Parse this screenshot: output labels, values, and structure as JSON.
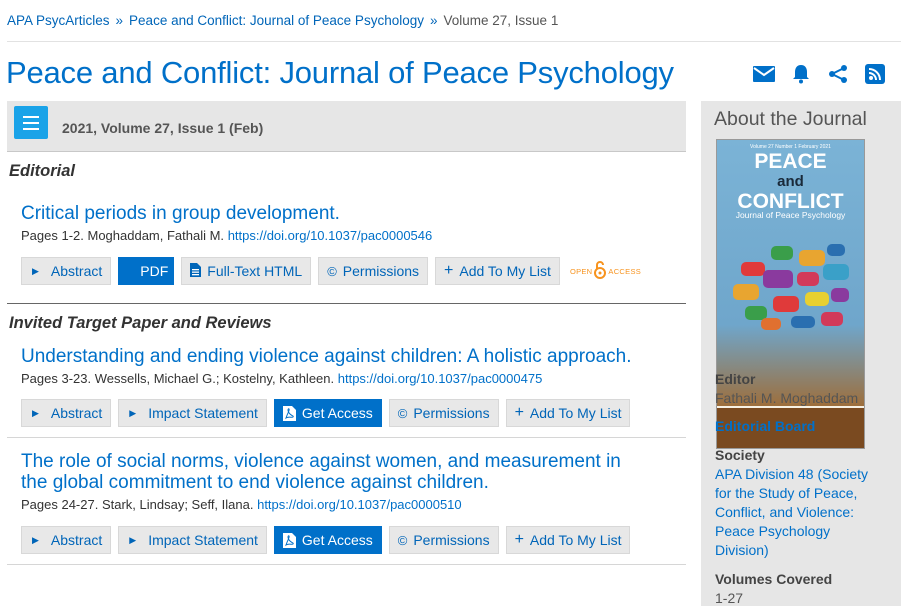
{
  "breadcrumb": {
    "items": [
      "APA PsycArticles",
      "Peace and Conflict: Journal of Peace Psychology",
      "Volume 27, Issue 1"
    ],
    "separator": "»"
  },
  "header": {
    "title": "Peace and Conflict: Journal of Peace Psychology",
    "icons": [
      "email-icon",
      "bell-icon",
      "share-icon",
      "rss-icon"
    ],
    "accent": "#0070c9"
  },
  "issue": {
    "label": "2021, Volume 27, Issue 1 (Feb)"
  },
  "sections": [
    {
      "heading": "Editorial",
      "articles": [
        {
          "title": "Critical periods in group development.",
          "meta": "Pages 1-2. Moghaddam, Fathali M.",
          "doi": "https://doi.org/10.1037/pac0000546",
          "buttons": [
            "Abstract",
            "PDF",
            "Full-Text HTML",
            "Permissions",
            "Add To My List"
          ],
          "open_access": "OPEN ACCESS"
        }
      ]
    },
    {
      "heading": "Invited Target Paper and Reviews",
      "articles": [
        {
          "title": "Understanding and ending violence against children: A holistic approach.",
          "meta": "Pages 3-23. Wessells, Michael G.; Kostelny, Kathleen.",
          "doi": "https://doi.org/10.1037/pac0000475",
          "buttons": [
            "Abstract",
            "Impact Statement",
            "Get Access",
            "Permissions",
            "Add To My List"
          ]
        },
        {
          "title_line1": "The role of social norms, violence against women, and measurement in",
          "title_line2": "the global commitment to end violence against children.",
          "meta": "Pages 24-27. Stark, Lindsay; Seff, Ilana.",
          "doi": "https://doi.org/10.1037/pac0000510",
          "buttons": [
            "Abstract",
            "Impact Statement",
            "Get Access",
            "Permissions",
            "Add To My List"
          ]
        }
      ]
    }
  ],
  "sidebar": {
    "heading": "About the Journal",
    "cover": {
      "volume_line": "Volume 27   Number 1   February 2021",
      "title_line1": "PEACE",
      "title_line2": "and",
      "title_line3": "CONFLICT",
      "subtitle": "Journal of Peace Psychology"
    },
    "editor_label": "Editor",
    "editor_name": "Fathali M. Moghaddam",
    "editorial_board": "Editorial Board",
    "society_label": "Society",
    "society_lines": [
      "APA Division 48 (Society",
      "for the Study of Peace,",
      "Conflict, and Violence:",
      "Peace Psychology",
      "Division)"
    ],
    "volumes_label": "Volumes Covered",
    "volumes_value": "1-27"
  }
}
